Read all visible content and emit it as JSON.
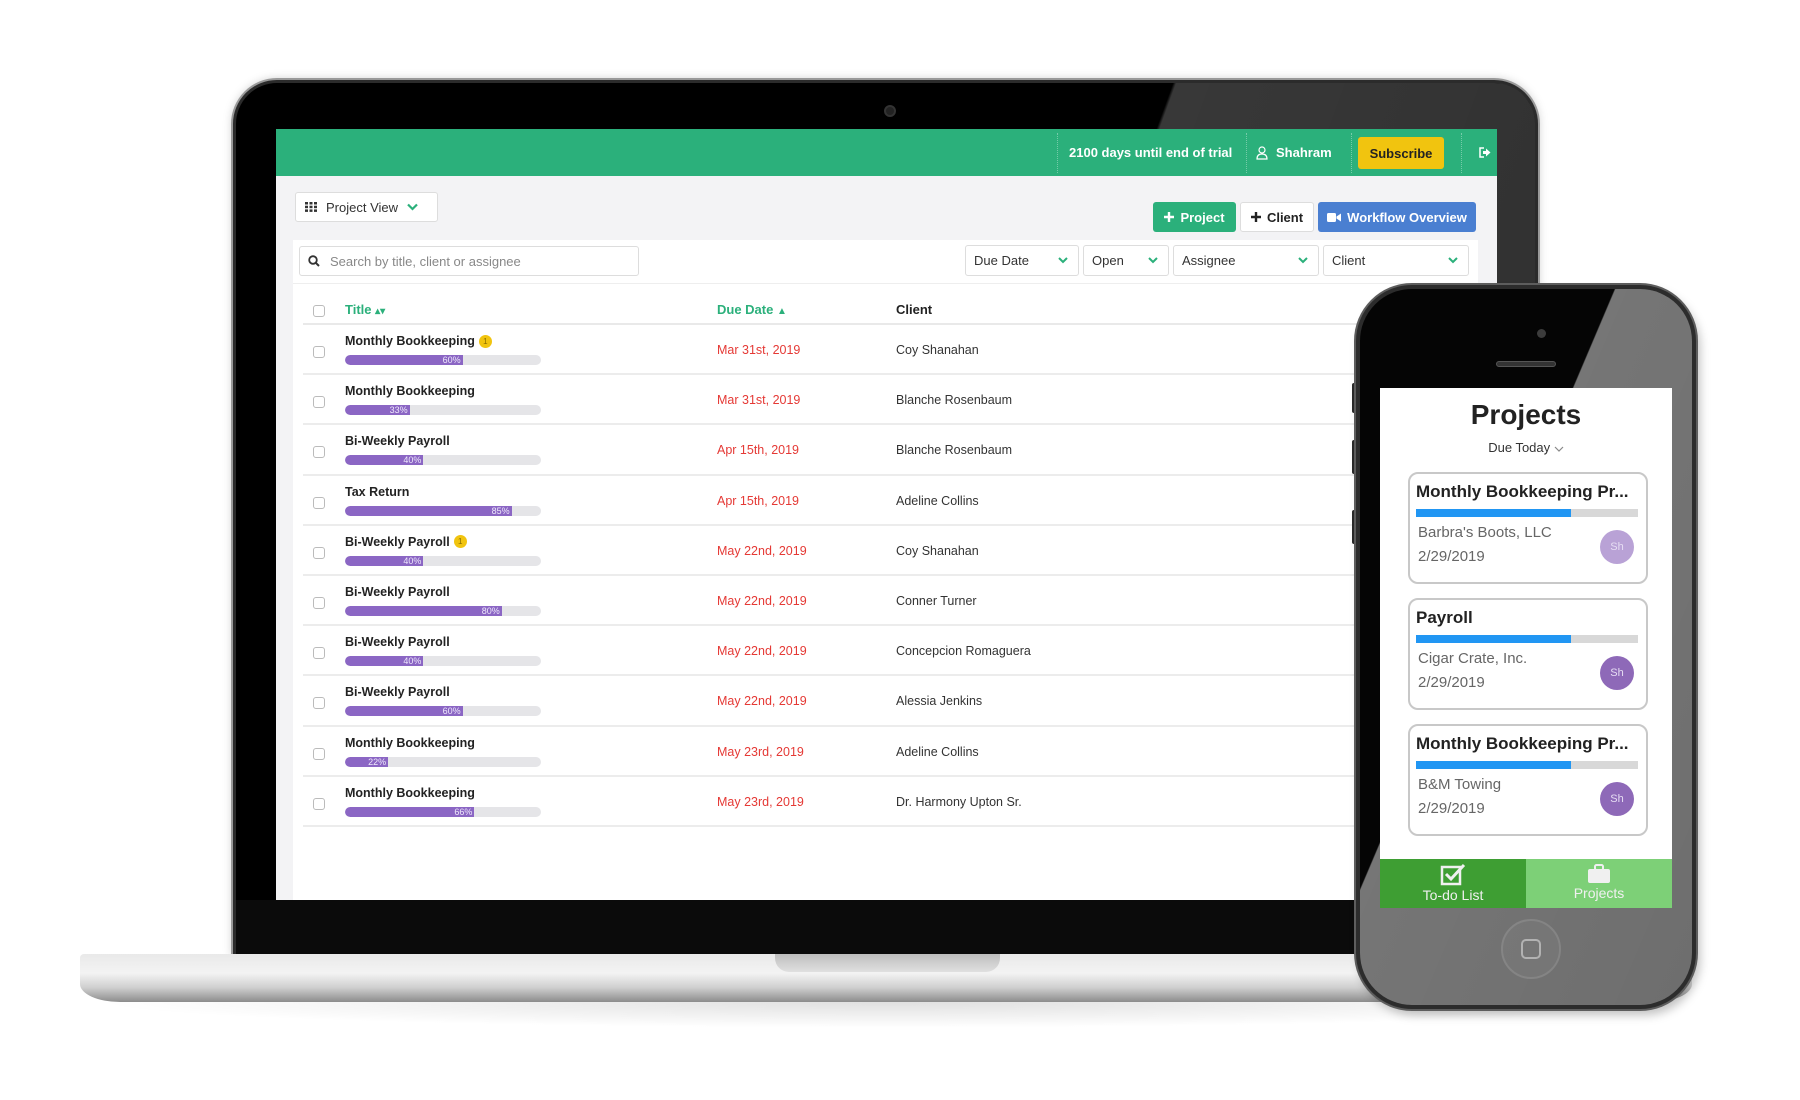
{
  "topbar": {
    "trial_text": "2100 days until end of trial",
    "user_name": "Shahram",
    "subscribe_label": "Subscribe",
    "brand_color": "#2bb07b",
    "subscribe_color": "#f1c40f"
  },
  "toolbar": {
    "view_selector_label": "Project View",
    "add_project_label": "Project",
    "add_client_label": "Client",
    "workflow_label": "Workflow Overview"
  },
  "search": {
    "placeholder": "Search by title, client or assignee",
    "value": ""
  },
  "filters": [
    {
      "label": "Due Date"
    },
    {
      "label": "Open"
    },
    {
      "label": "Assignee"
    },
    {
      "label": "Client"
    }
  ],
  "table": {
    "columns": {
      "title": "Title",
      "due_date": "Due Date",
      "client": "Client"
    },
    "sort": {
      "column": "Due Date",
      "direction": "ascending"
    },
    "rows": [
      {
        "title": "Monthly Bookkeeping",
        "badge": "1",
        "progress": 60,
        "progress_label": "60%",
        "due": "Mar 31st, 2019",
        "client": "Coy Shanahan"
      },
      {
        "title": "Monthly Bookkeeping",
        "badge": null,
        "progress": 33,
        "progress_label": "33%",
        "due": "Mar 31st, 2019",
        "client": "Blanche Rosenbaum"
      },
      {
        "title": "Bi-Weekly Payroll",
        "badge": null,
        "progress": 40,
        "progress_label": "40%",
        "due": "Apr 15th, 2019",
        "client": "Blanche Rosenbaum"
      },
      {
        "title": "Tax Return",
        "badge": null,
        "progress": 85,
        "progress_label": "85%",
        "due": "Apr 15th, 2019",
        "client": "Adeline Collins"
      },
      {
        "title": "Bi-Weekly Payroll",
        "badge": "1",
        "progress": 40,
        "progress_label": "40%",
        "due": "May 22nd, 2019",
        "client": "Coy Shanahan"
      },
      {
        "title": "Bi-Weekly Payroll",
        "badge": null,
        "progress": 80,
        "progress_label": "80%",
        "due": "May 22nd, 2019",
        "client": "Conner Turner"
      },
      {
        "title": "Bi-Weekly Payroll",
        "badge": null,
        "progress": 40,
        "progress_label": "40%",
        "due": "May 22nd, 2019",
        "client": "Concepcion Romaguera"
      },
      {
        "title": "Bi-Weekly Payroll",
        "badge": null,
        "progress": 60,
        "progress_label": "60%",
        "due": "May 22nd, 2019",
        "client": "Alessia Jenkins"
      },
      {
        "title": "Monthly Bookkeeping",
        "badge": null,
        "progress": 22,
        "progress_label": "22%",
        "due": "May 23rd, 2019",
        "client": "Adeline Collins"
      },
      {
        "title": "Monthly Bookkeeping",
        "badge": null,
        "progress": 66,
        "progress_label": "66%",
        "due": "May 23rd, 2019",
        "client": "Dr. Harmony Upton Sr."
      }
    ]
  },
  "phone": {
    "title": "Projects",
    "filter_label": "Due Today",
    "cards": [
      {
        "title": "Monthly Bookkeeping Pr...",
        "progress": 70,
        "client": "Barbra's Boots, LLC",
        "date": "2/29/2019",
        "avatar": "Sh"
      },
      {
        "title": "Payroll",
        "progress": 70,
        "client": "Cigar Crate, Inc.",
        "date": "2/29/2019",
        "avatar": "Sh"
      },
      {
        "title": "Monthly Bookkeeping Pr...",
        "progress": 70,
        "client": "B&M Towing",
        "date": "2/29/2019",
        "avatar": "Sh"
      }
    ],
    "tabs": [
      {
        "label": "To-do List",
        "icon": "checkbox-icon",
        "active": true
      },
      {
        "label": "Projects",
        "icon": "briefcase-icon",
        "active": false
      }
    ]
  }
}
